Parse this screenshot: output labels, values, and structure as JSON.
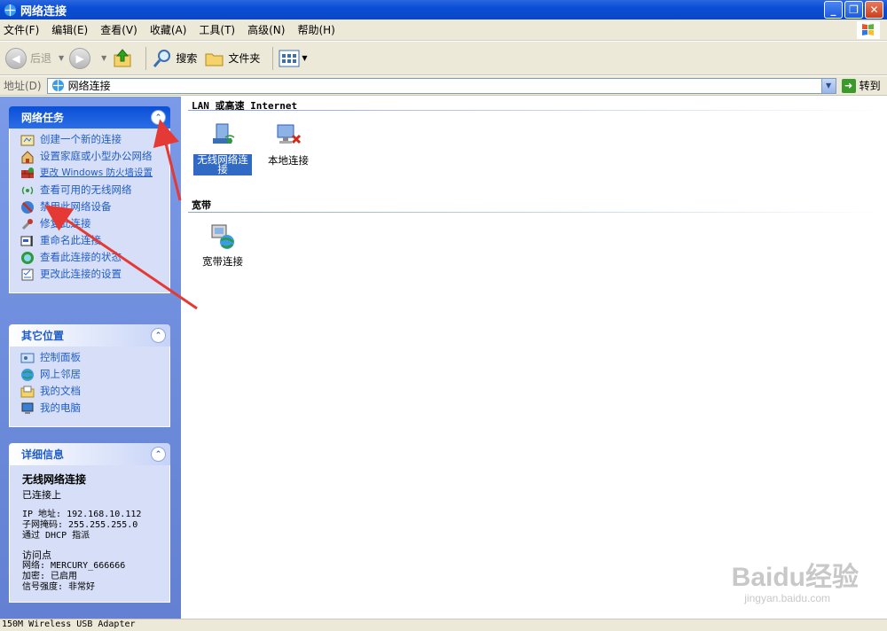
{
  "window": {
    "title": "网络连接",
    "minimize": "_",
    "restore": "❐",
    "close": "✕"
  },
  "menu": [
    "文件(F)",
    "编辑(E)",
    "查看(V)",
    "收藏(A)",
    "工具(T)",
    "高级(N)",
    "帮助(H)"
  ],
  "toolbar": {
    "back": "后退",
    "search": "搜索",
    "folders": "文件夹"
  },
  "address": {
    "label": "地址(D)",
    "value": "网络连接",
    "go": "转到"
  },
  "network_tasks": {
    "title": "网络任务",
    "items": [
      {
        "label": "创建一个新的连接",
        "icon": "new-connection-icon"
      },
      {
        "label": "设置家庭或小型办公网络",
        "icon": "home-network-icon"
      },
      {
        "label": "更改 Windows 防火墙设置",
        "icon": "firewall-icon"
      },
      {
        "label": "查看可用的无线网络",
        "icon": "wireless-icon"
      },
      {
        "label": "禁用此网络设备",
        "icon": "disable-icon"
      },
      {
        "label": "修复此连接",
        "icon": "repair-icon"
      },
      {
        "label": "重命名此连接",
        "icon": "rename-icon"
      },
      {
        "label": "查看此连接的状态",
        "icon": "status-icon"
      },
      {
        "label": "更改此连接的设置",
        "icon": "settings-icon"
      }
    ]
  },
  "other_places": {
    "title": "其它位置",
    "items": [
      {
        "label": "控制面板",
        "icon": "control-panel-icon"
      },
      {
        "label": "网上邻居",
        "icon": "network-places-icon"
      },
      {
        "label": "我的文档",
        "icon": "my-documents-icon"
      },
      {
        "label": "我的电脑",
        "icon": "my-computer-icon"
      }
    ]
  },
  "details": {
    "title": "详细信息",
    "name": "无线网络连接",
    "state": "已连接上",
    "ip": "IP 地址: 192.168.10.112",
    "mask": "子网掩码: 255.255.255.0",
    "dhcp": "通过 DHCP 指派",
    "ap": "访问点",
    "ssid": "网络: MERCURY_666666",
    "encryption": "加密: 已启用",
    "signal": "信号强度: 非常好"
  },
  "groups": {
    "lan": {
      "title": "LAN 或高速 Internet",
      "items": [
        "无线网络连接",
        "本地连接"
      ]
    },
    "broadband": {
      "title": "宽带",
      "items": [
        "宽带连接"
      ]
    }
  },
  "status": "150M Wireless USB Adapter",
  "watermark": {
    "text": "Baidu经验",
    "url": "jingyan.baidu.com"
  },
  "colors": {
    "title_bar": "#0a4fd6",
    "task_link": "#215dc6",
    "annotation": "#e53935",
    "selection": "#316ac5"
  }
}
